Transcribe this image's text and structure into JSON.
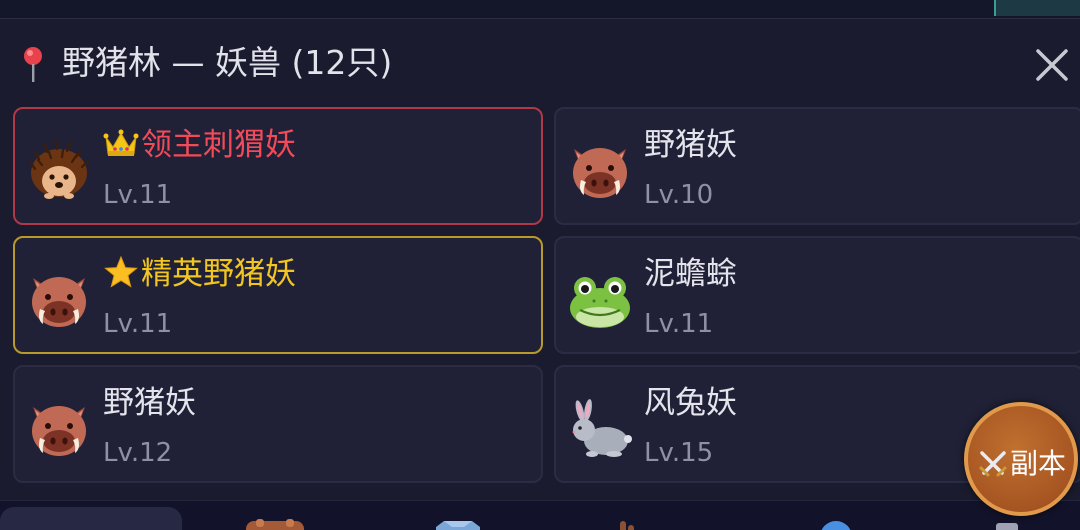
{
  "header": {
    "title": "野猪林 — 妖兽 (12只)",
    "location_icon": "map-pin-icon",
    "close_icon": "close-icon"
  },
  "monsters": [
    {
      "name": "领主刺猬妖",
      "level": "Lv.11",
      "rank": "boss",
      "rank_icon": "crown-icon",
      "icon": "hedgehog-icon",
      "name_color": "#f24a58"
    },
    {
      "name": "野猪妖",
      "level": "Lv.10",
      "rank": "normal",
      "icon": "boar-icon"
    },
    {
      "name": "精英野猪妖",
      "level": "Lv.11",
      "rank": "elite",
      "rank_icon": "star-icon",
      "icon": "boar-icon",
      "name_color": "#f2c51f"
    },
    {
      "name": "泥蟾蜍",
      "level": "Lv.11",
      "rank": "normal",
      "icon": "frog-icon"
    },
    {
      "name": "野猪妖",
      "level": "Lv.12",
      "rank": "normal",
      "icon": "boar-icon"
    },
    {
      "name": "风兔妖",
      "level": "Lv.15",
      "rank": "normal",
      "icon": "rabbit-icon"
    }
  ],
  "dungeon_button": {
    "label": "副本",
    "icon": "crossed-swords-icon"
  },
  "colors": {
    "background": "#1a1b2e",
    "card": "#202137",
    "boss_border": "#b03847",
    "elite_border": "#b89a2a",
    "fab": "#b05d26"
  }
}
